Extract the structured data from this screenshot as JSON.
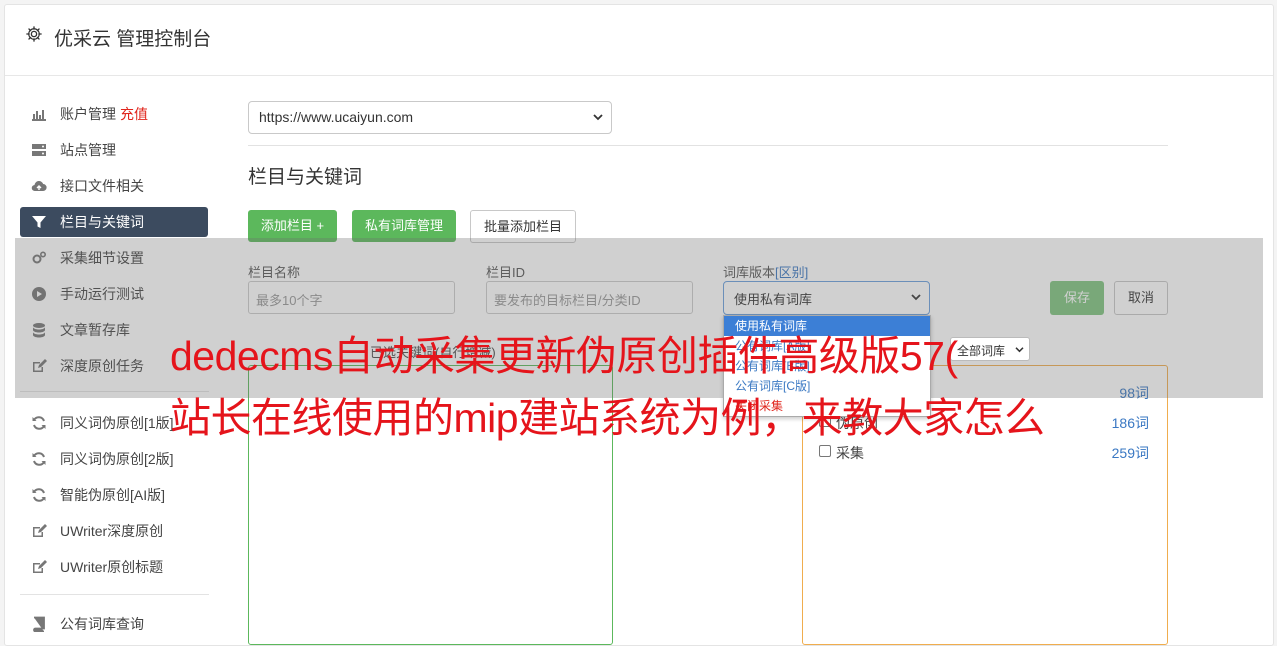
{
  "app": {
    "title": "优采云 管理控制台"
  },
  "sidebar": {
    "items": [
      {
        "label": "账户管理",
        "extra": "充值",
        "icon": "bar-chart-icon"
      },
      {
        "label": "站点管理",
        "icon": "server-icon"
      },
      {
        "label": "接口文件相关",
        "icon": "cloud-upload-icon"
      },
      {
        "label": "栏目与关键词",
        "icon": "filter-icon",
        "active": true
      },
      {
        "label": "采集细节设置",
        "icon": "cogs-icon"
      },
      {
        "label": "手动运行测试",
        "icon": "play-circle-icon"
      },
      {
        "label": "文章暂存库",
        "icon": "database-icon"
      },
      {
        "label": "深度原创任务",
        "icon": "edit-icon"
      },
      {
        "label": "同义词伪原创[1版]",
        "icon": "refresh-icon"
      },
      {
        "label": "同义词伪原创[2版]",
        "icon": "refresh-icon"
      },
      {
        "label": "智能伪原创[AI版]",
        "icon": "refresh-icon"
      },
      {
        "label": "UWriter深度原创",
        "icon": "edit-icon"
      },
      {
        "label": "UWriter原创标题",
        "icon": "edit-icon"
      },
      {
        "label": "公有词库查询",
        "icon": "book-icon"
      }
    ]
  },
  "main": {
    "site_select": {
      "value": "https://www.ucaiyun.com"
    },
    "section_title": "栏目与关键词",
    "buttons": {
      "add_column": "添加栏目 +",
      "private_lib": "私有词库管理",
      "batch_add": "批量添加栏目"
    },
    "form": {
      "name_label": "栏目名称",
      "name_placeholder": "最多10个字",
      "id_label": "栏目ID",
      "id_placeholder": "要发布的目标栏目/分类ID",
      "lib_label": "词库版本",
      "lib_label_link": "[区别]",
      "lib_value": "使用私有词库",
      "save": "保存",
      "cancel": "取消"
    },
    "dropdown_options": [
      {
        "label": "使用私有词库",
        "selected": true
      },
      {
        "label": "公有词库[A版]"
      },
      {
        "label": "公有词库[B版]"
      },
      {
        "label": "公有词库[C版]"
      },
      {
        "label": "关闭采集",
        "style": "red"
      }
    ],
    "keyword_box": {
      "header_left": "已选关键词(自行增减)",
      "filter_select": "全部词库"
    },
    "libraries": [
      {
        "name": "",
        "count": "98词"
      },
      {
        "name": "伪原创",
        "count": "186词"
      },
      {
        "name": "采集",
        "count": "259词"
      }
    ]
  },
  "watermark": {
    "line1": "dedecms自动采集更新伪原创插件高级版57(",
    "line2": "站长在线使用的mip建站系统为例，来教大家怎么"
  },
  "colors": {
    "accent_green": "#5cb85c",
    "active_nav": "#3c4b5f",
    "watermark_red": "#e5141b",
    "link_blue": "#3a78c3"
  }
}
